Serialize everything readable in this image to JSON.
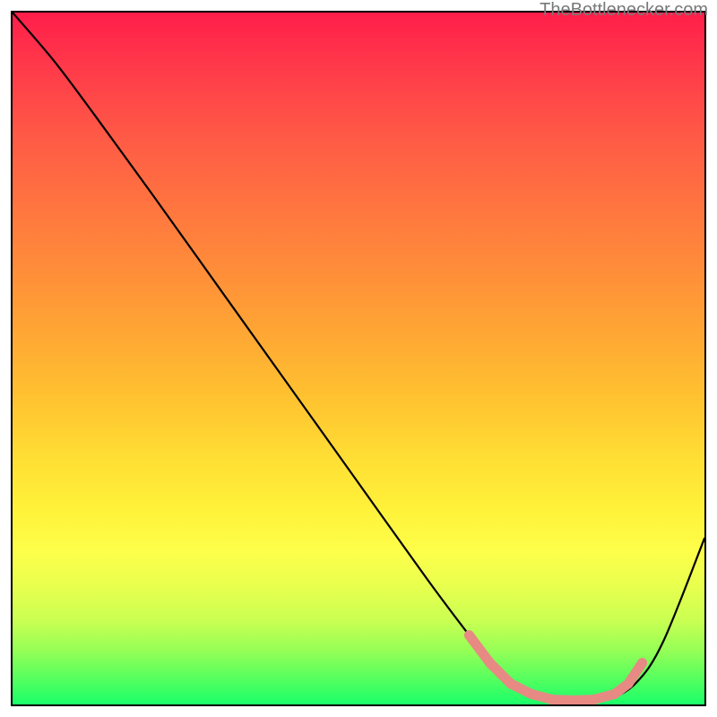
{
  "watermark_text": "TheBottlenecker.com",
  "chart_data": {
    "type": "line",
    "title": "",
    "xlabel": "",
    "ylabel": "",
    "xlim": [
      0,
      100
    ],
    "ylim": [
      0,
      100
    ],
    "series": [
      {
        "name": "bottleneck-curve",
        "x": [
          0,
          6,
          12,
          20,
          30,
          40,
          50,
          60,
          66,
          70,
          74,
          78,
          82,
          86,
          90,
          94,
          100
        ],
        "y": [
          100,
          93,
          85,
          74,
          60,
          46,
          32,
          18,
          10,
          5,
          2,
          0.7,
          0.5,
          0.8,
          3,
          9,
          24
        ]
      }
    ],
    "highlight_band": {
      "name": "optimal-range",
      "points_x": [
        66,
        69,
        72,
        75,
        78,
        81,
        84,
        87,
        89,
        91
      ],
      "points_y": [
        10,
        6,
        3,
        1.5,
        0.7,
        0.6,
        0.7,
        1.5,
        3,
        6
      ]
    },
    "gradient_stops": [
      {
        "pos": 0,
        "color": "#ff1e4a"
      },
      {
        "pos": 50,
        "color": "#ffc030"
      },
      {
        "pos": 78,
        "color": "#fdff4a"
      },
      {
        "pos": 100,
        "color": "#1aff6a"
      }
    ]
  }
}
